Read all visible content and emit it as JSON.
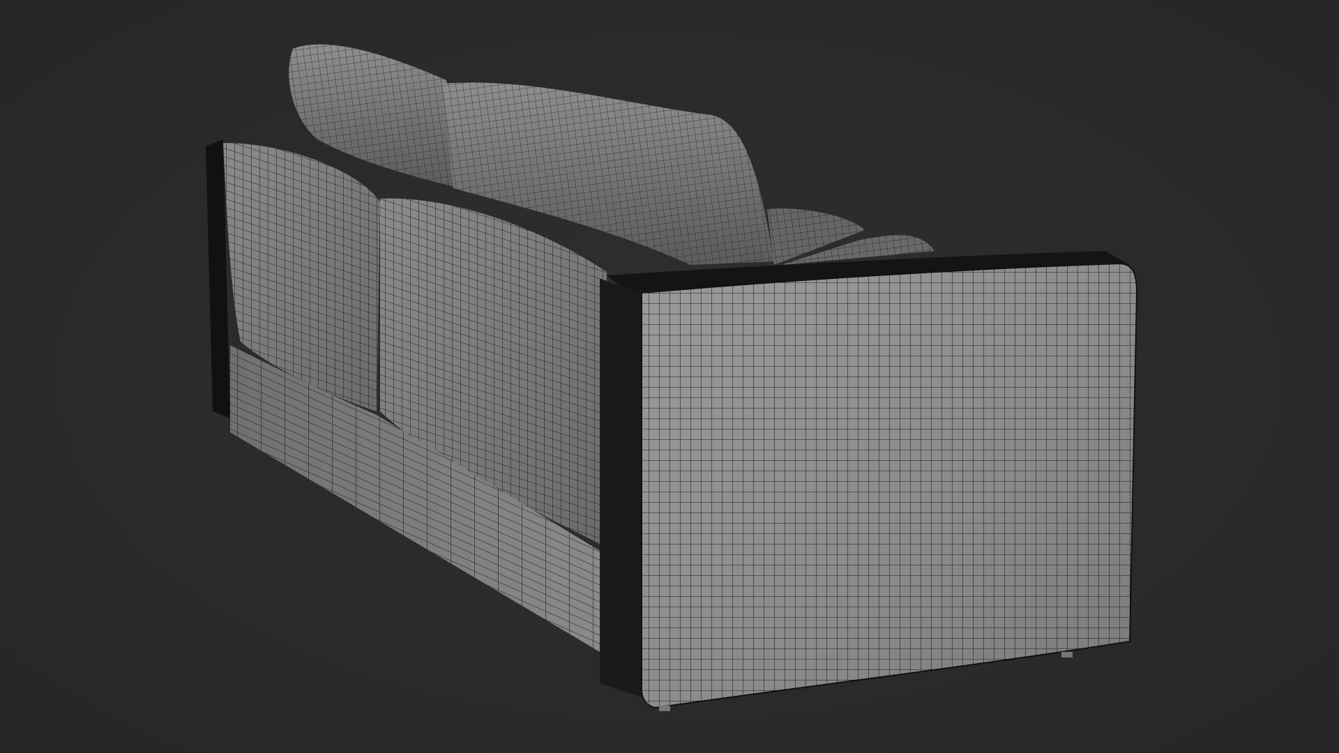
{
  "scene": {
    "subject": "sofa-wireframe-render",
    "colors": {
      "background": "#2a2a2a",
      "surface_light": "#8c8c8c",
      "surface_mid": "#6e6e6e",
      "surface_dark": "#4a4a4a",
      "wire": "#1e1e1e",
      "shadow": "#0d0d0d"
    }
  }
}
